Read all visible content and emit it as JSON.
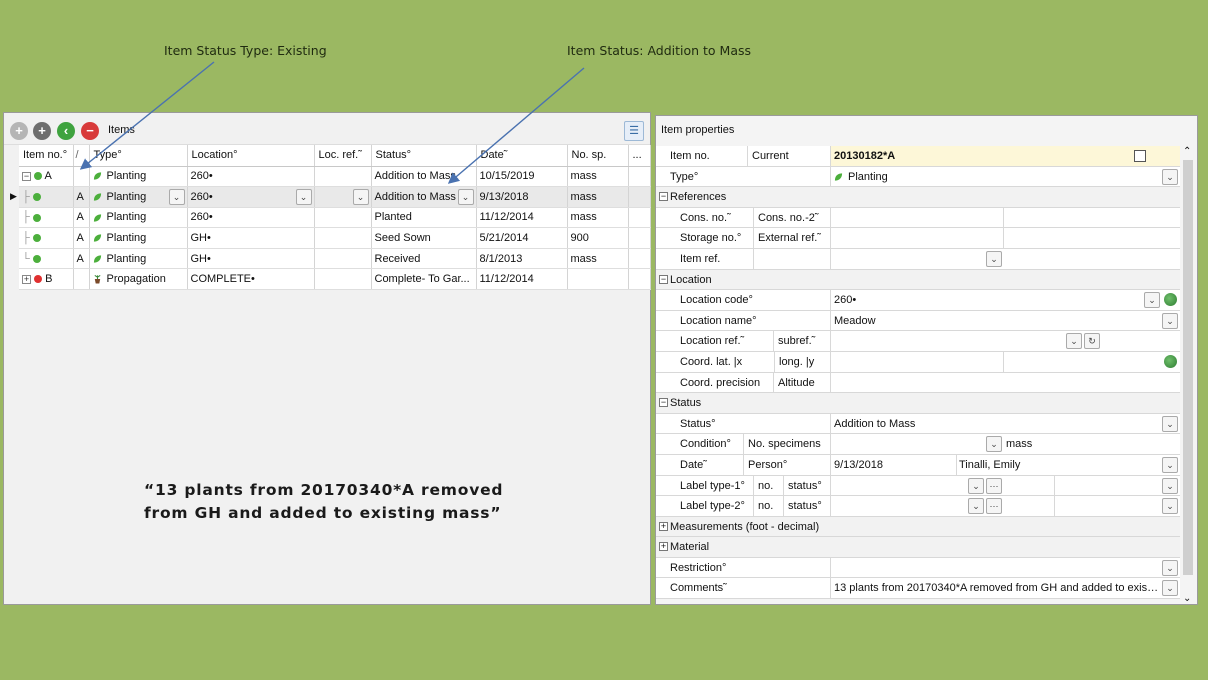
{
  "annotations": {
    "status_type": "Item Status Type: Existing",
    "status": "Item Status: Addition to Mass",
    "quote_line1": "“13 plants from 20170340*A removed",
    "quote_line2": "from GH and added to existing mass”"
  },
  "items_panel": {
    "title": "Items",
    "columns": [
      "Item no.°",
      "/",
      "Type°",
      "Location°",
      "Loc. ref.˜",
      "Status°",
      "Date˜",
      "No. sp.",
      "..."
    ],
    "rows": [
      {
        "item": "A",
        "type": "Planting",
        "location": "260•",
        "status": "Addition to Mass",
        "date": "10/15/2019",
        "no_sp": "mass",
        "dot": "green"
      },
      {
        "item": "A",
        "type": "Planting",
        "location": "260•",
        "status": "Addition to Mass",
        "date": "9/13/2018",
        "no_sp": "mass",
        "dot": "green"
      },
      {
        "item": "A",
        "type": "Planting",
        "location": "260•",
        "status": "Planted",
        "date": "11/12/2014",
        "no_sp": "mass",
        "dot": "green"
      },
      {
        "item": "A",
        "type": "Planting",
        "location": "GH•",
        "status": "Seed Sown",
        "date": "5/21/2014",
        "no_sp": "900",
        "dot": "green"
      },
      {
        "item": "A",
        "type": "Planting",
        "location": "GH•",
        "status": "Received",
        "date": "8/1/2013",
        "no_sp": "mass",
        "dot": "green"
      },
      {
        "item": "B",
        "type": "Propagation",
        "location": "COMPLETE•",
        "status": "Complete- To Gar...",
        "date": "11/12/2014",
        "no_sp": "",
        "dot": "red"
      }
    ]
  },
  "props_panel": {
    "title": "Item properties",
    "item_no_label": "Item no.",
    "current_label": "Current",
    "item_no_value": "20130182*A",
    "type_label": "Type°",
    "type_value": "Planting",
    "sec_references": "References",
    "cons_no": "Cons. no.˜",
    "cons_no2": "Cons. no.-2˜",
    "storage_no": "Storage no.°",
    "external_ref": "External ref.˜",
    "item_ref": "Item ref.",
    "sec_location": "Location",
    "location_code": "Location code°",
    "location_code_value": "260•",
    "location_name": "Location name°",
    "location_name_value": "Meadow",
    "location_ref": "Location ref.˜",
    "subref": "subref.˜",
    "coord_lat": "Coord. lat.",
    "lat_x": "x",
    "long_lab": "long.",
    "long_y": "y",
    "coord_precision": "Coord. precision",
    "altitude": "Altitude",
    "sec_status": "Status",
    "status_label": "Status°",
    "status_value": "Addition to Mass",
    "condition": "Condition°",
    "no_specimens": "No. specimens",
    "no_specimens_value": "mass",
    "date_label": "Date˜",
    "person_label": "Person°",
    "date_value": "9/13/2018",
    "person_value": "Tinalli, Emily",
    "label_type1": "Label type-1°",
    "label_type2": "Label type-2°",
    "no_lab": "no.",
    "status_small": "status°",
    "sec_measurements": "Measurements (foot - decimal)",
    "sec_material": "Material",
    "restriction": "Restriction°",
    "comments": "Comments˜",
    "comments_value": "13 plants from 20170340*A removed from GH and added to existi..."
  },
  "colors": {
    "background": "#9bb862",
    "arrow": "#4a72b0",
    "green_dot": "#4caf3c",
    "red_dot": "#e03030"
  }
}
